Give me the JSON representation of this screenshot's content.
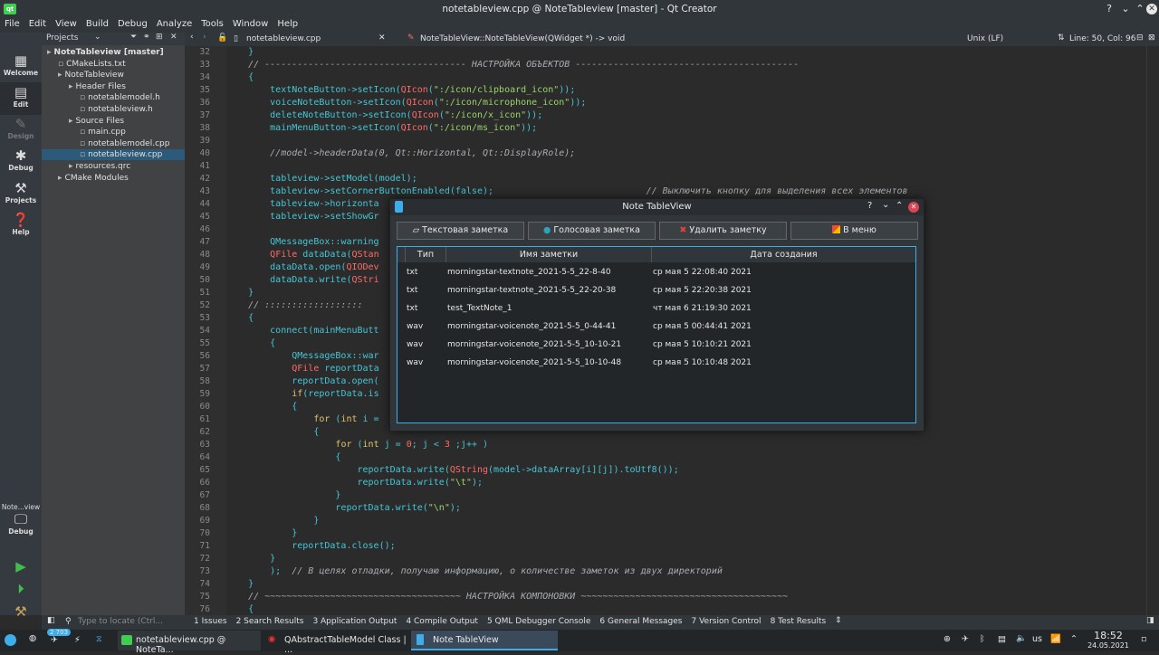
{
  "window": {
    "title": "notetableview.cpp @ NoteTableview [master] - Qt Creator"
  },
  "menu": [
    "File",
    "Edit",
    "View",
    "Build",
    "Debug",
    "Analyze",
    "Tools",
    "Window",
    "Help"
  ],
  "modes": [
    {
      "label": "Welcome",
      "icon": "grid-icon"
    },
    {
      "label": "Edit",
      "icon": "edit-icon"
    },
    {
      "label": "Design",
      "icon": "pencil-icon"
    },
    {
      "label": "Debug",
      "icon": "bug-icon"
    },
    {
      "label": "Projects",
      "icon": "wrench-icon"
    },
    {
      "label": "Help",
      "icon": "help-icon"
    }
  ],
  "kit": {
    "target": "Note...view",
    "mode": "Debug"
  },
  "projects": {
    "header": "Projects",
    "tree": [
      {
        "label": "NoteTableview [master]",
        "depth": 0,
        "bold": true
      },
      {
        "label": "CMakeLists.txt",
        "depth": 1
      },
      {
        "label": "NoteTableview",
        "depth": 1
      },
      {
        "label": "Header Files",
        "depth": 2
      },
      {
        "label": "notetablemodel.h",
        "depth": 3
      },
      {
        "label": "notetableview.h",
        "depth": 3
      },
      {
        "label": "Source Files",
        "depth": 2
      },
      {
        "label": "main.cpp",
        "depth": 3
      },
      {
        "label": "notetablemodel.cpp",
        "depth": 3
      },
      {
        "label": "notetableview.cpp",
        "depth": 3,
        "selected": true
      },
      {
        "label": "resources.qrc",
        "depth": 2
      },
      {
        "label": "CMake Modules",
        "depth": 1
      }
    ]
  },
  "editor": {
    "file": "notetableview.cpp",
    "symbol": "NoteTableView::NoteTableView(QWidget *) -> void",
    "line_ending": "Unix (LF)",
    "position": "Line: 50, Col: 96"
  },
  "code": {
    "lines": [
      {
        "n": "32",
        "t": "    }"
      },
      {
        "n": "33",
        "t": "    // ------------------------------------- НАСТРОЙКА ОБЪЕКТОВ -----------------------------------------"
      },
      {
        "n": "34",
        "t": "    {"
      },
      {
        "n": "35",
        "t": "        textNoteButton->setIcon(QIcon(\":/icon/clipboard_icon\"));"
      },
      {
        "n": "36",
        "t": "        voiceNoteButton->setIcon(QIcon(\":/icon/microphone_icon\"));"
      },
      {
        "n": "37",
        "t": "        deleteNoteButton->setIcon(QIcon(\":/icon/x_icon\"));"
      },
      {
        "n": "38",
        "t": "        mainMenuButton->setIcon(QIcon(\":/icon/ms_icon\"));"
      },
      {
        "n": "39",
        "t": ""
      },
      {
        "n": "40",
        "t": "        //model->headerData(0, Qt::Horizontal, Qt::DisplayRole);"
      },
      {
        "n": "41",
        "t": ""
      },
      {
        "n": "42",
        "t": "        tableview->setModel(model);"
      },
      {
        "n": "43",
        "t": "        tableview->setCornerButtonEnabled(false);                            // Выключить кнопку для выделения всех элементов"
      },
      {
        "n": "44",
        "t": "        tableview->horizonta                                                                                 леднего столбца"
      },
      {
        "n": "45",
        "t": "        tableview->setShowGr"
      },
      {
        "n": "46",
        "t": ""
      },
      {
        "n": "47",
        "t": "        QMessageBox::warning"
      },
      {
        "n": "48",
        "t": "        QFile dataData(QStan"
      },
      {
        "n": "49",
        "t": "        dataData.open(QIODev"
      },
      {
        "n": "50",
        "t": "        dataData.write(QStri"
      },
      {
        "n": "51",
        "t": "    }"
      },
      {
        "n": "52",
        "t": "    // ::::::::::::::::::"
      },
      {
        "n": "53",
        "t": "    {"
      },
      {
        "n": "54",
        "t": "        connect(mainMenuButt"
      },
      {
        "n": "55",
        "t": "        {"
      },
      {
        "n": "56",
        "t": "            QMessageBox::war"
      },
      {
        "n": "57",
        "t": "            QFile reportData                                                                                 .txt\");"
      },
      {
        "n": "58",
        "t": "            reportData.open("
      },
      {
        "n": "59",
        "t": "            if(reportData.is"
      },
      {
        "n": "60",
        "t": "            {"
      },
      {
        "n": "61",
        "t": "                for (int i ="
      },
      {
        "n": "62",
        "t": "                {"
      },
      {
        "n": "63",
        "t": "                    for (int j = 0; j < 3 ;j++ )"
      },
      {
        "n": "64",
        "t": "                    {"
      },
      {
        "n": "65",
        "t": "                        reportData.write(QString(model->dataArray[i][j]).toUtf8());"
      },
      {
        "n": "66",
        "t": "                        reportData.write(\"\\t\");"
      },
      {
        "n": "67",
        "t": "                    }"
      },
      {
        "n": "68",
        "t": "                    reportData.write(\"\\n\");"
      },
      {
        "n": "69",
        "t": "                }"
      },
      {
        "n": "70",
        "t": "            }"
      },
      {
        "n": "71",
        "t": "            reportData.close();"
      },
      {
        "n": "72",
        "t": "        }"
      },
      {
        "n": "73",
        "t": "        );  // В целях отладки, получаю информацию, о количестве заметок из двух директорий"
      },
      {
        "n": "74",
        "t": "    }"
      },
      {
        "n": "75",
        "t": "    // ~~~~~~~~~~~~~~~~~~~~~~~~~~~~~~~~~~~~ НАСТРОЙКА КОМПОНОВКИ ~~~~~~~~~~~~~~~~~~~~~~~~~~~~~~~~~~~~~~"
      },
      {
        "n": "76",
        "t": "    {"
      }
    ]
  },
  "dialog": {
    "title": "Note TableView",
    "buttons": [
      {
        "label": "Текстовая заметка",
        "icon": "clipboard-icon"
      },
      {
        "label": "Голосовая заметка",
        "icon": "microphone-icon"
      },
      {
        "label": "Удалить заметку",
        "icon": "x-icon"
      },
      {
        "label": "В меню",
        "icon": "ms-icon"
      }
    ],
    "columns": [
      "Тип",
      "Имя заметки",
      "Дата создания"
    ],
    "rows": [
      [
        "txt",
        "morningstar-textnote_2021-5-5_22-8-40",
        "ср мая 5 22:08:40 2021"
      ],
      [
        "txt",
        "morningstar-textnote_2021-5-5_22-20-38",
        "ср мая 5 22:20:38 2021"
      ],
      [
        "txt",
        "test_TextNote_1",
        "чт мая 6 21:19:30 2021"
      ],
      [
        "wav",
        "morningstar-voicenote_2021-5-5_0-44-41",
        "ср мая 5 00:44:41 2021"
      ],
      [
        "wav",
        "morningstar-voicenote_2021-5-5_10-10-21",
        "ср мая 5 10:10:21 2021"
      ],
      [
        "wav",
        "morningstar-voicenote_2021-5-5_10-10-48",
        "ср мая 5 10:10:48 2021"
      ]
    ]
  },
  "statusbar": {
    "locator_placeholder": "Type to locate (Ctrl...",
    "tabs": [
      "1 Issues",
      "2 Search Results",
      "3 Application Output",
      "4 Compile Output",
      "5 QML Debugger Console",
      "6 General Messages",
      "7 Version Control",
      "8 Test Results"
    ]
  },
  "taskbar": {
    "tasks": [
      "notetableview.cpp @ NoteTa...",
      "QAbstractTableModel Class | ...",
      "Note TableView"
    ],
    "badge": "2 703",
    "keyboard": "us",
    "time": "18:52",
    "date": "24.05.2021"
  },
  "colors": {
    "accent": "#3daee9",
    "keyword": "#45c6d6",
    "comment": "#a8abb0",
    "string": "#d69aa7",
    "macro": "#ff6b68"
  }
}
